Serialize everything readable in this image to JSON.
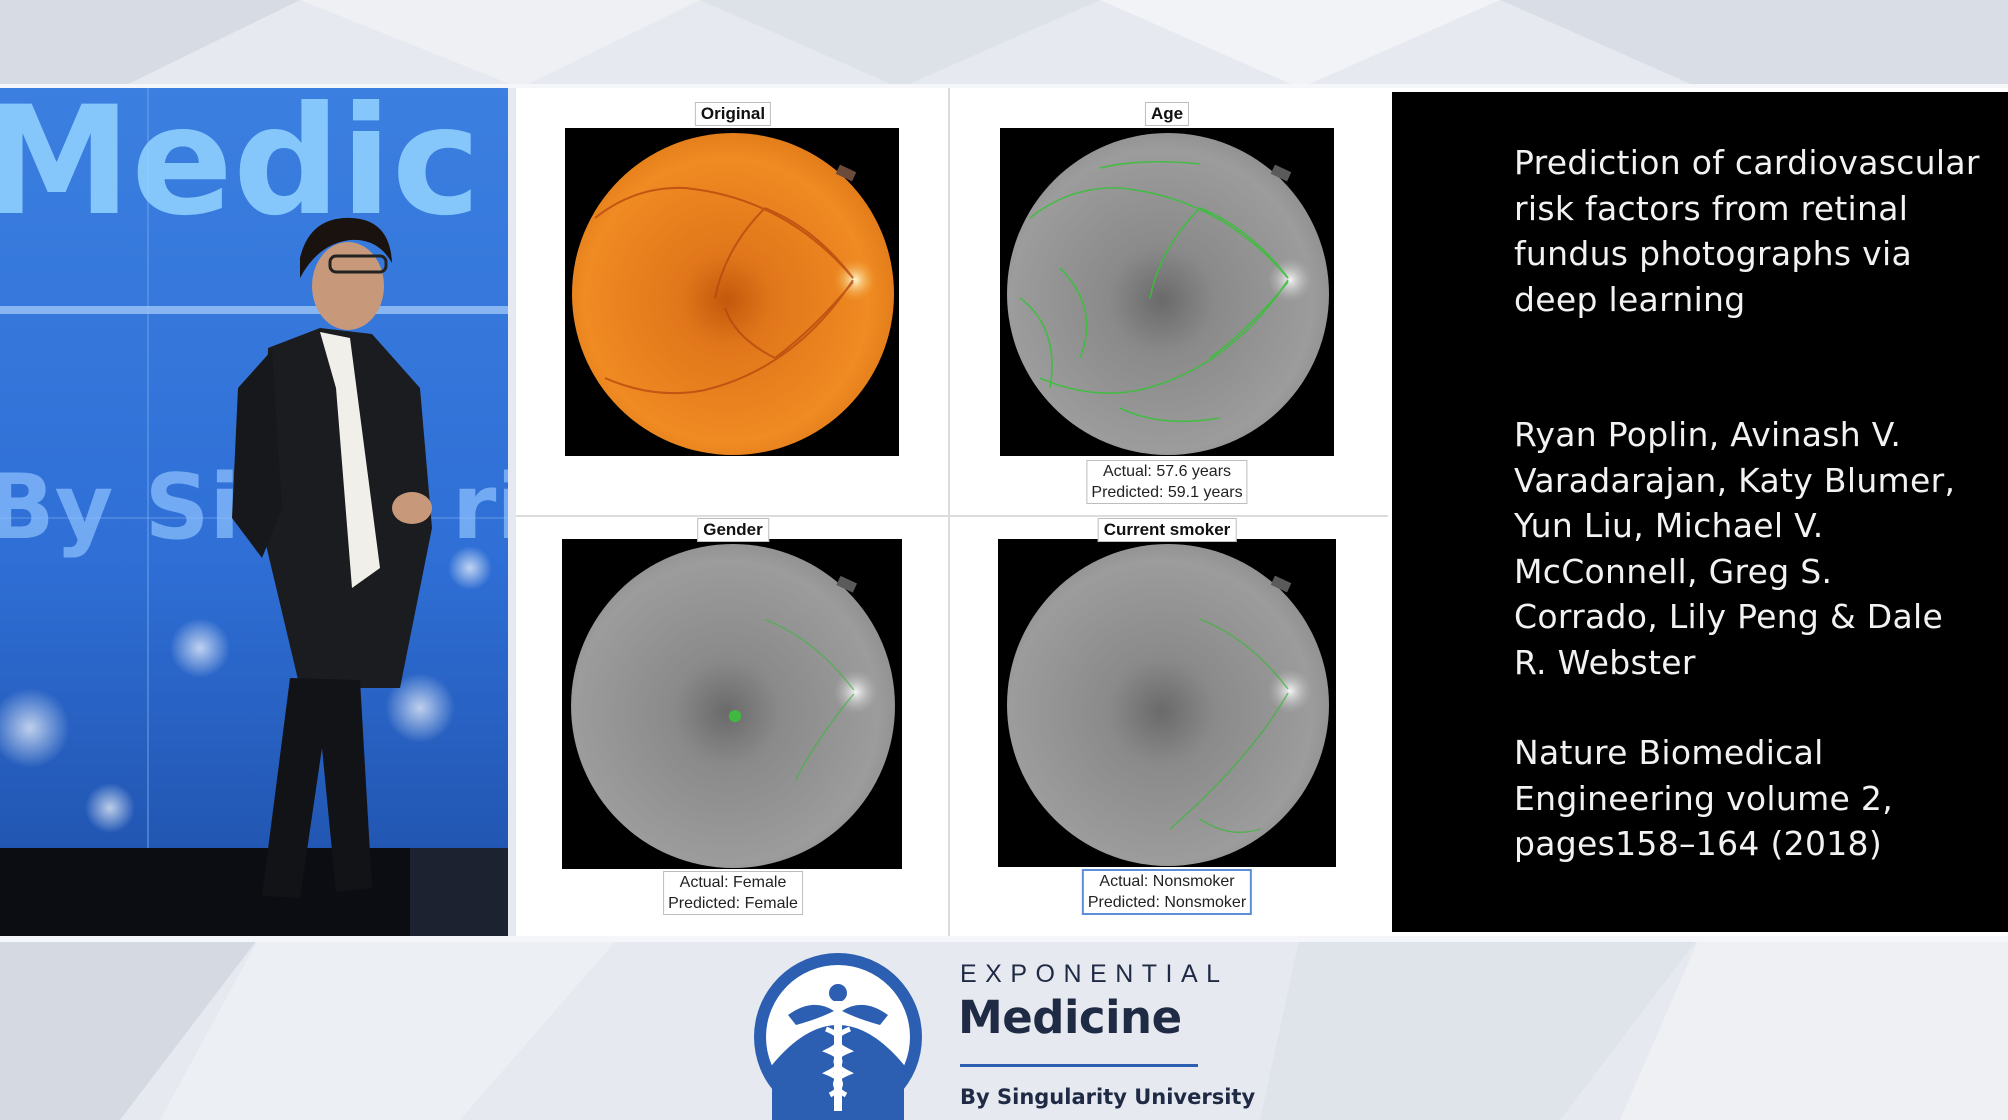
{
  "slide": {
    "panels": [
      {
        "title": "Original",
        "caption": []
      },
      {
        "title": "Age",
        "caption": [
          "Actual: 57.6 years",
          "Predicted: 59.1 years"
        ]
      },
      {
        "title": "Gender",
        "caption": [
          "Actual: Female",
          "Predicted: Female"
        ]
      },
      {
        "title": "Current smoker",
        "caption": [
          "Actual: Nonsmoker",
          "Predicted: Nonsmoker"
        ]
      }
    ],
    "paper_title": "Prediction of cardiovascular risk factors from retinal fundus photographs via deep learning",
    "authors": "Ryan Poplin, Avinash V. Varadarajan, Katy Blumer, Yun Liu, Michael V. McConnell, Greg S. Corrado, Lily Peng & Dale R. Webster",
    "citation": "Nature Biomedical Engineering volume 2, pages158–164 (2018)"
  },
  "stage_backdrop": {
    "line1": "Medic",
    "line2": "By Sin",
    "line2_tail": "ri"
  },
  "logo": {
    "line1": "EXPONENTIAL",
    "line2": "Medicine",
    "line3": "By Singularity University"
  },
  "colors": {
    "brand_blue": "#2c5fb2",
    "logo_text": "#1f2a44",
    "slide_text": "#f2f2f2",
    "fundus_orange": "#e8801e",
    "heatmap_green": "#33cc33"
  }
}
